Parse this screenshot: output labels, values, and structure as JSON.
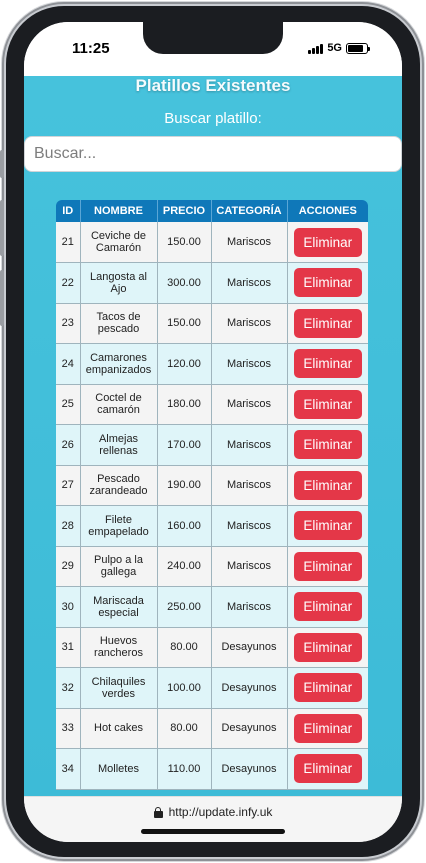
{
  "status_bar": {
    "time": "11:25",
    "network": "5G",
    "battery_level": 0.85
  },
  "page": {
    "title": "Platillos Existentes",
    "search_label": "Buscar platillo:",
    "search_placeholder": "Buscar..."
  },
  "table": {
    "headers": [
      "ID",
      "NOMBRE",
      "PRECIO",
      "CATEGORÍA",
      "ACCIONES"
    ],
    "delete_label": "Eliminar",
    "rows": [
      {
        "id": "21",
        "nombre": "Ceviche de Camarón",
        "precio": "150.00",
        "categoria": "Mariscos"
      },
      {
        "id": "22",
        "nombre": "Langosta al Ajo",
        "precio": "300.00",
        "categoria": "Mariscos"
      },
      {
        "id": "23",
        "nombre": "Tacos de pescado",
        "precio": "150.00",
        "categoria": "Mariscos"
      },
      {
        "id": "24",
        "nombre": "Camarones empanizados",
        "precio": "120.00",
        "categoria": "Mariscos"
      },
      {
        "id": "25",
        "nombre": "Coctel de camarón",
        "precio": "180.00",
        "categoria": "Mariscos"
      },
      {
        "id": "26",
        "nombre": "Almejas rellenas",
        "precio": "170.00",
        "categoria": "Mariscos"
      },
      {
        "id": "27",
        "nombre": "Pescado zarandeado",
        "precio": "190.00",
        "categoria": "Mariscos"
      },
      {
        "id": "28",
        "nombre": "Filete empapelado",
        "precio": "160.00",
        "categoria": "Mariscos"
      },
      {
        "id": "29",
        "nombre": "Pulpo a la gallega",
        "precio": "240.00",
        "categoria": "Mariscos"
      },
      {
        "id": "30",
        "nombre": "Mariscada especial",
        "precio": "250.00",
        "categoria": "Mariscos"
      },
      {
        "id": "31",
        "nombre": "Huevos rancheros",
        "precio": "80.00",
        "categoria": "Desayunos"
      },
      {
        "id": "32",
        "nombre": "Chilaquiles verdes",
        "precio": "100.00",
        "categoria": "Desayunos"
      },
      {
        "id": "33",
        "nombre": "Hot cakes",
        "precio": "80.00",
        "categoria": "Desayunos"
      },
      {
        "id": "34",
        "nombre": "Molletes",
        "precio": "110.00",
        "categoria": "Desayunos"
      }
    ]
  },
  "url_bar": {
    "url": "http://update.infy.uk"
  },
  "colors": {
    "page_background": "#46c2dc",
    "header_background": "#0f78b9",
    "delete_button": "#e43748",
    "row_odd": "#f4f4f4",
    "row_even": "#dff5f9"
  }
}
